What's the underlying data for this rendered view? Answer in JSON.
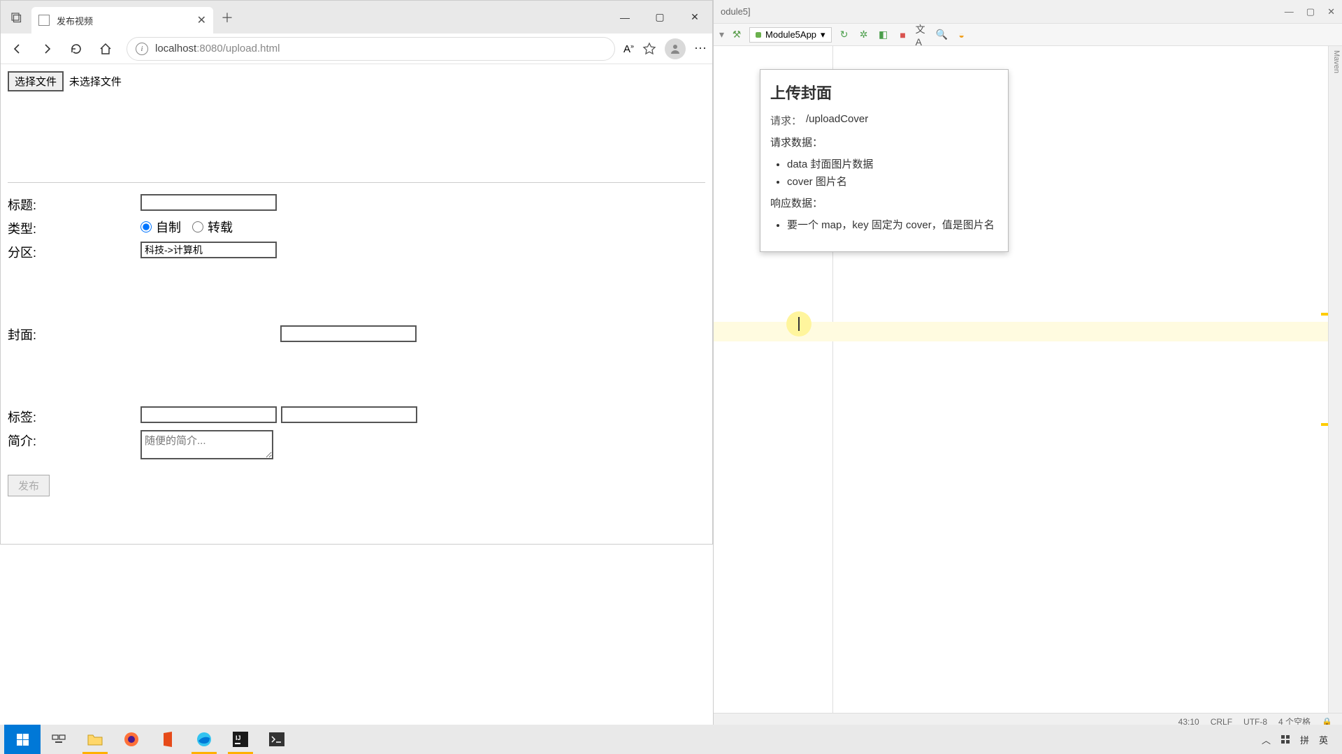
{
  "browser": {
    "tab_title": "发布视频",
    "url_host": "localhost",
    "url_port": ":8080",
    "url_path": "/upload.html"
  },
  "page": {
    "file_button": "选择文件",
    "file_status": "未选择文件",
    "labels": {
      "title": "标题:",
      "type": "类型:",
      "category": "分区:",
      "cover": "封面:",
      "tags": "标签:",
      "intro": "简介:"
    },
    "type_options": {
      "self": "自制",
      "repost": "转载"
    },
    "category_value": "科技->计算机",
    "intro_placeholder": "随便的简介...",
    "submit": "发布"
  },
  "ide": {
    "title_fragment": "odule5]",
    "run_config": "Module5App",
    "sidebar_label": "Maven",
    "doc": {
      "title": "上传封面",
      "request_label": "请求：",
      "request_value": "/uploadCover",
      "request_data_label": "请求数据：",
      "req_items": [
        "data 封面图片数据",
        "cover 图片名"
      ],
      "response_data_label": "响应数据：",
      "resp_items": [
        "要一个 map，key 固定为 cover，值是图片名"
      ]
    },
    "status": {
      "pos": "43:10",
      "line_sep": "CRLF",
      "encoding": "UTF-8",
      "indent": "4 个空格"
    }
  },
  "taskbar": {
    "ime_lang1": "拼",
    "ime_lang2": "英"
  }
}
